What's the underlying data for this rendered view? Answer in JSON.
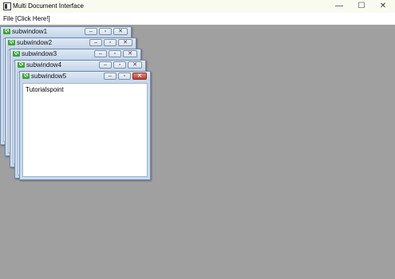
{
  "window": {
    "title": "Multi Document Interface",
    "controls": {
      "minimize": "—",
      "maximize": "☐",
      "close": "✕"
    }
  },
  "menu": {
    "file_label": "File [Click Here!]"
  },
  "subwindows": [
    {
      "title": "subwindow1",
      "icon": "Qt"
    },
    {
      "title": "subwindow2",
      "icon": "Qt"
    },
    {
      "title": "subwindow3",
      "icon": "Qt"
    },
    {
      "title": "subwindow4",
      "icon": "Qt"
    },
    {
      "title": "subwindow5",
      "icon": "Qt",
      "content": "Tutorialspoint"
    }
  ],
  "subwindow_buttons": {
    "minimize": "–",
    "restore": "▫",
    "close": "✕"
  },
  "colors": {
    "workspace": "#a0a0a0",
    "titlebar": "#f9fbf1",
    "active_close": "#c33a2a",
    "qt_icon": "#3aa535"
  }
}
